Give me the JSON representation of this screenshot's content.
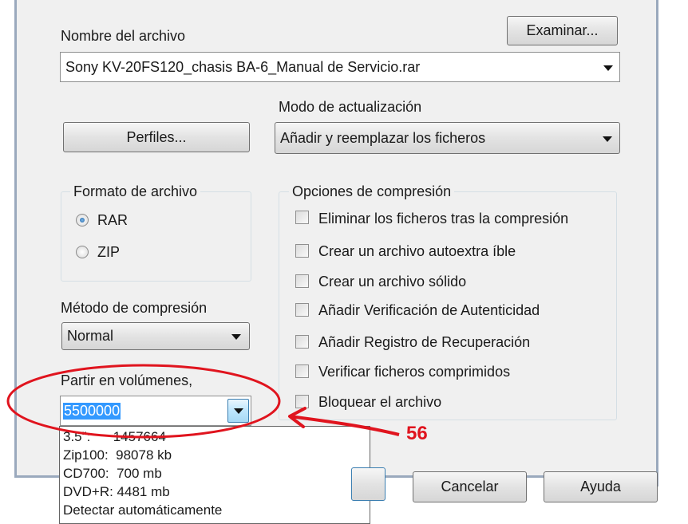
{
  "file": {
    "name_label": "Nombre del archivo",
    "browse_label": "Examinar...",
    "filename_value": "Sony KV-20FS120_chasis BA-6_Manual de Servicio.rar"
  },
  "profiles_label": "Perfiles...",
  "update_mode": {
    "label": "Modo de actualización",
    "value": "Añadir y reemplazar los ficheros"
  },
  "format": {
    "legend": "Formato de archivo",
    "options": [
      "RAR",
      "ZIP"
    ],
    "selected": "RAR"
  },
  "compression_method": {
    "label": "Método de compresión",
    "value": "Normal"
  },
  "volumes": {
    "label": "Partir en volúmenes,",
    "value": "5500000",
    "options": [
      "3.5\":      1457664",
      "Zip100:  98078 kb",
      "CD700:  700 mb",
      "DVD+R: 4481 mb",
      "Detectar automáticamente"
    ]
  },
  "options": {
    "legend": "Opciones de compresión",
    "items": [
      "Eliminar los ficheros tras la compresión",
      "Crear un archivo autoextra íble",
      "Crear un archivo sólido",
      "Añadir Verificación de Autenticidad",
      "Añadir Registro de Recuperación",
      "Verificar ficheros comprimidos",
      "Bloquear el archivo"
    ]
  },
  "buttons": {
    "cancel": "Cancelar",
    "help": "Ayuda"
  },
  "annotation": {
    "number": "56",
    "color": "#e0141e"
  }
}
